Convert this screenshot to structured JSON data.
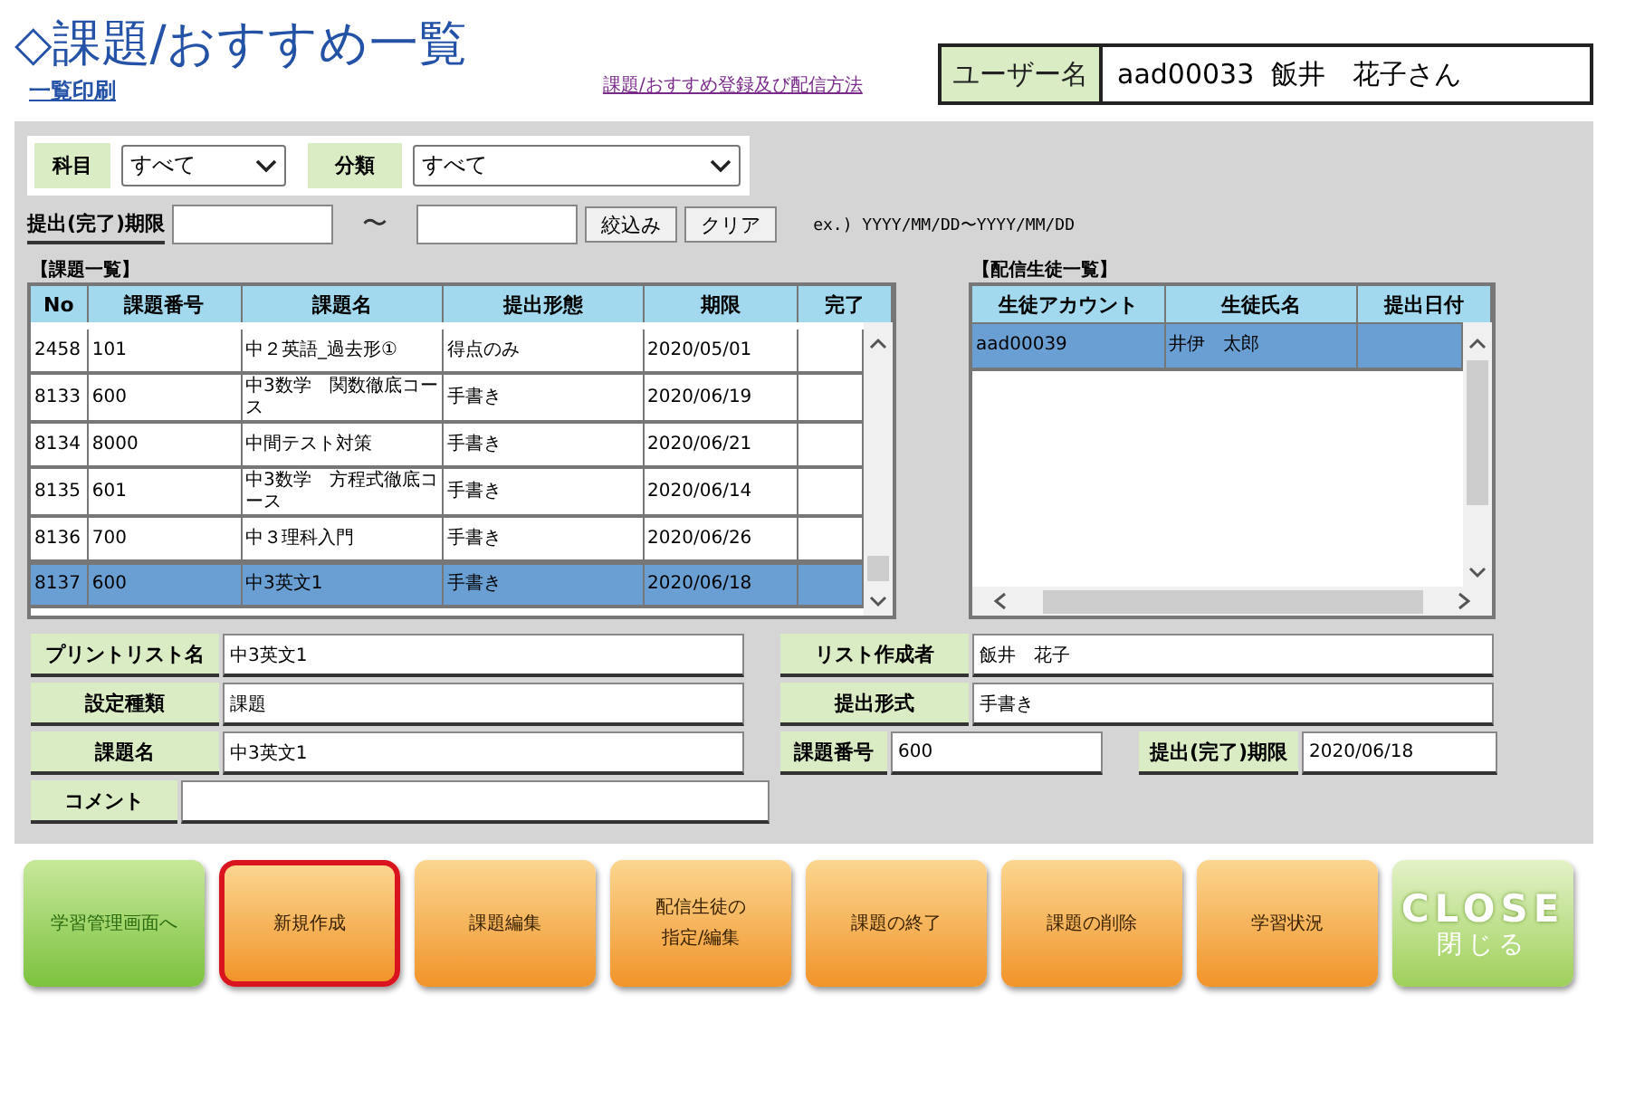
{
  "title": "◇課題/おすすめ一覧",
  "print_link": "一覧印刷",
  "help_link": "課題/おすすめ登録及び配信方法",
  "user": {
    "label": "ユーザー名",
    "value": "aad00033  飯井　花子さん"
  },
  "filters": {
    "subject": {
      "label": "科目",
      "value": "すべて"
    },
    "category": {
      "label": "分類",
      "value": "すべて"
    },
    "deadline": {
      "label": "提出(完了)期限",
      "separator": "〜",
      "hint": "ex.) YYYY/MM/DD〜YYYY/MM/DD"
    },
    "buttons": [
      "絞込み",
      "クリア"
    ]
  },
  "task_list": {
    "title": "【課題一覧】",
    "columns": [
      "No",
      "課題番号",
      "課題名",
      "提出形態",
      "期限",
      "完了"
    ],
    "rows": [
      {
        "cells": [
          "2458",
          "101",
          "中２英語_過去形①",
          "得点のみ",
          "2020/05/01",
          ""
        ],
        "selected": false
      },
      {
        "cells": [
          "8133",
          "600",
          "中3数学　関数徹底コース",
          "手書き",
          "2020/06/19",
          ""
        ],
        "selected": false
      },
      {
        "cells": [
          "8134",
          "8000",
          "中間テスト対策",
          "手書き",
          "2020/06/21",
          ""
        ],
        "selected": false
      },
      {
        "cells": [
          "8135",
          "601",
          "中3数学　方程式徹底コース",
          "手書き",
          "2020/06/14",
          ""
        ],
        "selected": false
      },
      {
        "cells": [
          "8136",
          "700",
          "中３理科入門",
          "手書き",
          "2020/06/26",
          ""
        ],
        "selected": false
      },
      {
        "cells": [
          "8137",
          "600",
          "中3英文1",
          "手書き",
          "2020/06/18",
          ""
        ],
        "selected": true
      }
    ]
  },
  "student_list": {
    "title": "【配信生徒一覧】",
    "columns": [
      "生徒アカウント",
      "生徒氏名",
      "提出日付"
    ],
    "rows": [
      {
        "cells": [
          "aad00039",
          "井伊　太郎",
          ""
        ],
        "selected": true
      }
    ]
  },
  "details": [
    {
      "label": "プリントリスト名",
      "value": "中3英文1"
    },
    {
      "label": "リスト作成者",
      "value": "飯井　花子"
    },
    {
      "label": "設定種類",
      "value": "課題"
    },
    {
      "label": "提出形式",
      "value": "手書き"
    },
    {
      "label": "課題名",
      "value": "中3英文1"
    },
    {
      "label": "課題番号",
      "value": "600"
    },
    {
      "label": "提出(完了)期限",
      "value": "2020/06/18"
    },
    {
      "label": "コメント"
    }
  ],
  "actions": [
    {
      "label": "学習管理画面へ",
      "kind": "green",
      "highlighted": false
    },
    {
      "label": "新規作成",
      "kind": "orange",
      "highlighted": true
    },
    {
      "label": "課題編集",
      "kind": "orange",
      "highlighted": false
    },
    {
      "label": "配信生徒の指定/編集",
      "kind": "orange",
      "highlighted": false
    },
    {
      "label": "課題の終了",
      "kind": "orange",
      "highlighted": false
    },
    {
      "label": "課題の削除",
      "kind": "orange",
      "highlighted": false
    },
    {
      "label": "学習状況",
      "kind": "orange",
      "highlighted": false
    },
    {
      "label": "CLOSE",
      "sublabel": "閉じる",
      "kind": "close",
      "highlighted": false
    }
  ]
}
